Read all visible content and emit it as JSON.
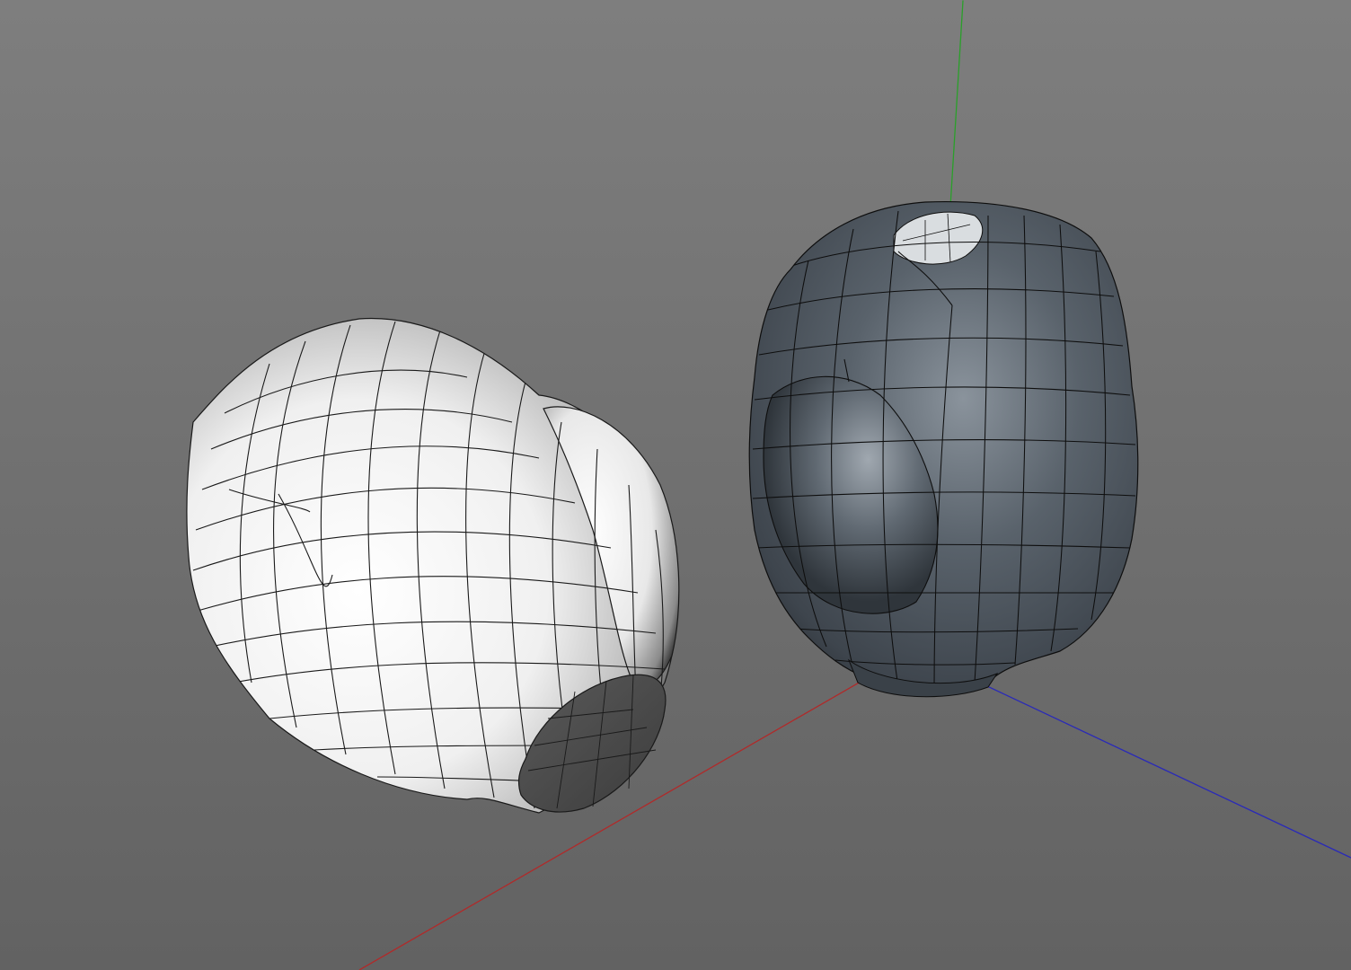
{
  "viewport": {
    "background_top": "#7e7e7e",
    "background_bottom": "#626262"
  },
  "axes": {
    "x_color": "#b02a2a",
    "y_color": "#2aa02a",
    "z_color": "#2a2ab8"
  },
  "objects": [
    {
      "name": "white-vase-mesh",
      "material_color": "#f2f2f2",
      "wireframe_color": "#1a1a1a"
    },
    {
      "name": "dark-vase-mesh",
      "material_color": "#4a525b",
      "wireframe_color": "#0e0e0e"
    }
  ]
}
